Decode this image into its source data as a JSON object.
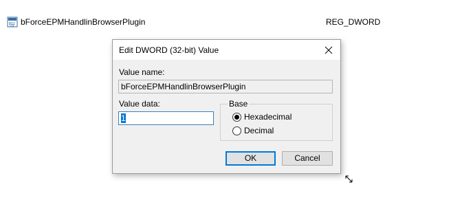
{
  "registry": {
    "value_name": "bForceEPMHandlinBrowserPlugin",
    "value_type": "REG_DWORD",
    "icon": "registry-binary-value-icon"
  },
  "dialog": {
    "title": "Edit DWORD (32-bit) Value",
    "close_icon": "close-icon",
    "value_name_label": "Value name:",
    "value_name": "bForceEPMHandlinBrowserPlugin",
    "value_data_label": "Value data:",
    "value_data": "1",
    "base": {
      "label": "Base",
      "options": [
        {
          "label": "Hexadecimal",
          "selected": true
        },
        {
          "label": "Decimal",
          "selected": false
        }
      ]
    },
    "ok_label": "OK",
    "cancel_label": "Cancel"
  },
  "colors": {
    "accent": "#0078d7",
    "dialog_bg": "#f0f0f0",
    "button_bg": "#e1e1e1"
  }
}
